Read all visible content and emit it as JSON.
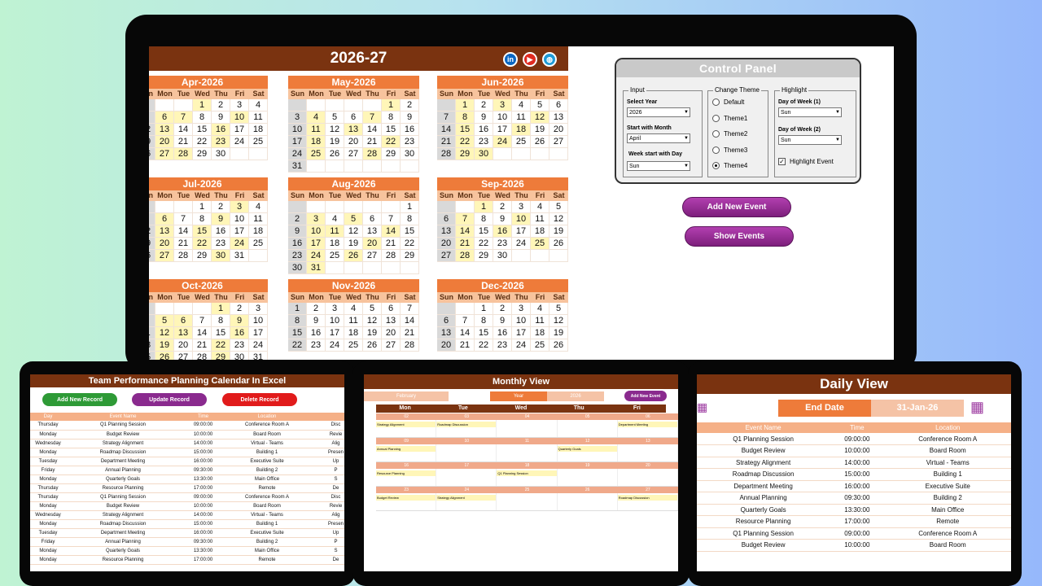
{
  "main": {
    "year_title": "2026-27",
    "social": [
      {
        "name": "linkedin-icon",
        "glyph": "in",
        "color": "#0a66c2"
      },
      {
        "name": "youtube-icon",
        "glyph": "▶",
        "color": "#e02b20"
      },
      {
        "name": "website-icon",
        "glyph": "◍",
        "color": "#1e9ad6"
      }
    ]
  },
  "weekdays": [
    "Sun",
    "Mon",
    "Tue",
    "Wed",
    "Thu",
    "Fri",
    "Sat"
  ],
  "months": [
    {
      "name": "Apr-2026",
      "weeks": [
        [
          "",
          "",
          "",
          "1",
          "2",
          "3",
          "4"
        ],
        [
          "5",
          "6",
          "7",
          "8",
          "9",
          "10",
          "11"
        ],
        [
          "12",
          "13",
          "14",
          "15",
          "16",
          "17",
          "18"
        ],
        [
          "19",
          "20",
          "21",
          "22",
          "23",
          "24",
          "25"
        ],
        [
          "26",
          "27",
          "28",
          "29",
          "30",
          "",
          ""
        ]
      ]
    },
    {
      "name": "May-2026",
      "weeks": [
        [
          "",
          "",
          "",
          "",
          "",
          "1",
          "2"
        ],
        [
          "3",
          "4",
          "5",
          "6",
          "7",
          "8",
          "9"
        ],
        [
          "10",
          "11",
          "12",
          "13",
          "14",
          "15",
          "16"
        ],
        [
          "17",
          "18",
          "19",
          "20",
          "21",
          "22",
          "23"
        ],
        [
          "24",
          "25",
          "26",
          "27",
          "28",
          "29",
          "30"
        ],
        [
          "31",
          "",
          "",
          "",
          "",
          "",
          ""
        ]
      ]
    },
    {
      "name": "Jun-2026",
      "weeks": [
        [
          "",
          "1",
          "2",
          "3",
          "4",
          "5",
          "6"
        ],
        [
          "7",
          "8",
          "9",
          "10",
          "11",
          "12",
          "13"
        ],
        [
          "14",
          "15",
          "16",
          "17",
          "18",
          "19",
          "20"
        ],
        [
          "21",
          "22",
          "23",
          "24",
          "25",
          "26",
          "27"
        ],
        [
          "28",
          "29",
          "30",
          "",
          "",
          "",
          ""
        ]
      ]
    },
    {
      "name": "Jul-2026",
      "weeks": [
        [
          "",
          "",
          "",
          "1",
          "2",
          "3",
          "4"
        ],
        [
          "5",
          "6",
          "7",
          "8",
          "9",
          "10",
          "11"
        ],
        [
          "12",
          "13",
          "14",
          "15",
          "16",
          "17",
          "18"
        ],
        [
          "19",
          "20",
          "21",
          "22",
          "23",
          "24",
          "25"
        ],
        [
          "26",
          "27",
          "28",
          "29",
          "30",
          "31",
          ""
        ]
      ]
    },
    {
      "name": "Aug-2026",
      "weeks": [
        [
          "",
          "",
          "",
          "",
          "",
          "",
          "1"
        ],
        [
          "2",
          "3",
          "4",
          "5",
          "6",
          "7",
          "8"
        ],
        [
          "9",
          "10",
          "11",
          "12",
          "13",
          "14",
          "15"
        ],
        [
          "16",
          "17",
          "18",
          "19",
          "20",
          "21",
          "22"
        ],
        [
          "23",
          "24",
          "25",
          "26",
          "27",
          "28",
          "29"
        ],
        [
          "30",
          "31",
          "",
          "",
          "",
          "",
          ""
        ]
      ]
    },
    {
      "name": "Sep-2026",
      "weeks": [
        [
          "",
          "",
          "1",
          "2",
          "3",
          "4",
          "5"
        ],
        [
          "6",
          "7",
          "8",
          "9",
          "10",
          "11",
          "12"
        ],
        [
          "13",
          "14",
          "15",
          "16",
          "17",
          "18",
          "19"
        ],
        [
          "20",
          "21",
          "22",
          "23",
          "24",
          "25",
          "26"
        ],
        [
          "27",
          "28",
          "29",
          "30",
          "",
          "",
          ""
        ]
      ]
    },
    {
      "name": "Oct-2026",
      "weeks": [
        [
          "",
          "",
          "",
          "",
          "1",
          "2",
          "3"
        ],
        [
          "4",
          "5",
          "6",
          "7",
          "8",
          "9",
          "10"
        ],
        [
          "11",
          "12",
          "13",
          "14",
          "15",
          "16",
          "17"
        ],
        [
          "18",
          "19",
          "20",
          "21",
          "22",
          "23",
          "24"
        ],
        [
          "25",
          "26",
          "27",
          "28",
          "29",
          "30",
          "31"
        ]
      ]
    },
    {
      "name": "Nov-2026",
      "weeks": [
        [
          "1",
          "2",
          "3",
          "4",
          "5",
          "6",
          "7"
        ],
        [
          "8",
          "9",
          "10",
          "11",
          "12",
          "13",
          "14"
        ],
        [
          "15",
          "16",
          "17",
          "18",
          "19",
          "20",
          "21"
        ],
        [
          "22",
          "23",
          "24",
          "25",
          "26",
          "27",
          "28"
        ]
      ]
    },
    {
      "name": "Dec-2026",
      "weeks": [
        [
          "",
          "",
          "1",
          "2",
          "3",
          "4",
          "5"
        ],
        [
          "6",
          "7",
          "8",
          "9",
          "10",
          "11",
          "12"
        ],
        [
          "13",
          "14",
          "15",
          "16",
          "17",
          "18",
          "19"
        ],
        [
          "20",
          "21",
          "22",
          "23",
          "24",
          "25",
          "26"
        ]
      ]
    }
  ],
  "highlight_dates": {
    "Apr-2026": [
      "1",
      "6",
      "7",
      "10",
      "13",
      "16",
      "20",
      "23",
      "27",
      "28"
    ],
    "May-2026": [
      "1",
      "4",
      "7",
      "11",
      "13",
      "18",
      "22",
      "25",
      "28"
    ],
    "Jun-2026": [
      "1",
      "3",
      "8",
      "12",
      "15",
      "18",
      "22",
      "24",
      "29",
      "30"
    ],
    "Jul-2026": [
      "3",
      "6",
      "9",
      "13",
      "15",
      "20",
      "22",
      "24",
      "27",
      "30"
    ],
    "Aug-2026": [
      "3",
      "5",
      "10",
      "11",
      "14",
      "17",
      "20",
      "24",
      "26",
      "31"
    ],
    "Sep-2026": [
      "1",
      "7",
      "10",
      "14",
      "16",
      "21",
      "25",
      "28"
    ],
    "Oct-2026": [
      "1",
      "5",
      "6",
      "9",
      "12",
      "13",
      "16",
      "19",
      "22",
      "26",
      "29"
    ],
    "Nov-2026": [],
    "Dec-2026": []
  },
  "control_panel": {
    "title": "Control Panel",
    "input_label": "Input",
    "select_year_label": "Select Year",
    "select_year": "2026",
    "start_month_label": "Start with Month",
    "start_month": "April",
    "week_start_label": "Week start with Day",
    "week_start": "Sun",
    "theme_label": "Change Theme",
    "themes": [
      "Default",
      "Theme1",
      "Theme2",
      "Theme3",
      "Theme4"
    ],
    "selected_theme": "Theme4",
    "highlight_label": "Highlight",
    "dow1_label": "Day of Week (1)",
    "dow1": "Sun",
    "dow2_label": "Day of Week (2)",
    "dow2": "Sun",
    "highlight_event_label": "Highlight Event"
  },
  "buttons": {
    "add_event": "Add New Event",
    "show_events": "Show Events"
  },
  "team": {
    "title": "Team Performance Planning Calendar In Excel",
    "add": "Add New Record",
    "update": "Update Record",
    "delete": "Delete Record",
    "headers": [
      "Day",
      "Event Name",
      "Time",
      "Location",
      ""
    ],
    "rows": [
      [
        "Thursday",
        "Q1 Planning Session",
        "09:00:00",
        "Conference Room A",
        "Disc"
      ],
      [
        "Monday",
        "Budget Review",
        "10:00:00",
        "Board Room",
        "Revie"
      ],
      [
        "Wednesday",
        "Strategy Alignment",
        "14:00:00",
        "Virtual - Teams",
        "Alig"
      ],
      [
        "Monday",
        "Roadmap Discussion",
        "15:00:00",
        "Building 1",
        "Presen"
      ],
      [
        "Tuesday",
        "Department Meeting",
        "16:00:00",
        "Executive Suite",
        "Up"
      ],
      [
        "Friday",
        "Annual Planning",
        "09:30:00",
        "Building 2",
        "P"
      ],
      [
        "Monday",
        "Quarterly Goals",
        "13:30:00",
        "Main Office",
        "S"
      ],
      [
        "Thursday",
        "Resource Planning",
        "17:00:00",
        "Remote",
        "De"
      ],
      [
        "Thursday",
        "Q1 Planning Session",
        "09:00:00",
        "Conference Room A",
        "Disc"
      ],
      [
        "Monday",
        "Budget Review",
        "10:00:00",
        "Board Room",
        "Revie"
      ],
      [
        "Wednesday",
        "Strategy Alignment",
        "14:00:00",
        "Virtual - Teams",
        "Alig"
      ],
      [
        "Monday",
        "Roadmap Discussion",
        "15:00:00",
        "Building 1",
        "Presen"
      ],
      [
        "Tuesday",
        "Department Meeting",
        "16:00:00",
        "Executive Suite",
        "Up"
      ],
      [
        "Friday",
        "Annual Planning",
        "09:30:00",
        "Building 2",
        "P"
      ],
      [
        "Monday",
        "Quarterly Goals",
        "13:30:00",
        "Main Office",
        "S"
      ],
      [
        "Monday",
        "Resource Planning",
        "17:00:00",
        "Remote",
        "De"
      ]
    ]
  },
  "monthly": {
    "title": "Monthly View",
    "month": "February",
    "year_label": "Year",
    "year": "2026",
    "add_event": "Add New Event",
    "days": [
      "Mon",
      "Tue",
      "Wed",
      "Thu",
      "Fri"
    ],
    "weeks": [
      {
        "dates": [
          "02",
          "03",
          "04",
          "05",
          "06"
        ],
        "events": [
          "Strategy Alignment",
          "Roadmap Discussion",
          "",
          "",
          "Department Meeting"
        ]
      },
      {
        "dates": [
          "09",
          "10",
          "11",
          "12",
          "13"
        ],
        "events": [
          "Annual Planning",
          "",
          "",
          "Quarterly Goals",
          ""
        ]
      },
      {
        "dates": [
          "16",
          "17",
          "18",
          "19",
          "20"
        ],
        "events": [
          "Resource Planning",
          "",
          "Q1 Planning Session",
          "",
          ""
        ]
      },
      {
        "dates": [
          "23",
          "24",
          "25",
          "26",
          "27"
        ],
        "events": [
          "Budget Review",
          "Strategy Alignment",
          "",
          "",
          "Roadmap Discussion"
        ]
      }
    ]
  },
  "daily": {
    "title": "Daily View",
    "end_date_label": "End Date",
    "end_date": "31-Jan-26",
    "headers": [
      "Event Name",
      "Time",
      "Location"
    ],
    "rows": [
      [
        "Q1 Planning Session",
        "09:00:00",
        "Conference Room A"
      ],
      [
        "Budget Review",
        "10:00:00",
        "Board Room"
      ],
      [
        "Strategy Alignment",
        "14:00:00",
        "Virtual - Teams"
      ],
      [
        "Roadmap Discussion",
        "15:00:00",
        "Building 1"
      ],
      [
        "Department Meeting",
        "16:00:00",
        "Executive Suite"
      ],
      [
        "Annual Planning",
        "09:30:00",
        "Building 2"
      ],
      [
        "Quarterly Goals",
        "13:30:00",
        "Main Office"
      ],
      [
        "Resource Planning",
        "17:00:00",
        "Remote"
      ],
      [
        "Q1 Planning Session",
        "09:00:00",
        "Conference Room A"
      ],
      [
        "Budget Review",
        "10:00:00",
        "Board Room"
      ]
    ]
  }
}
